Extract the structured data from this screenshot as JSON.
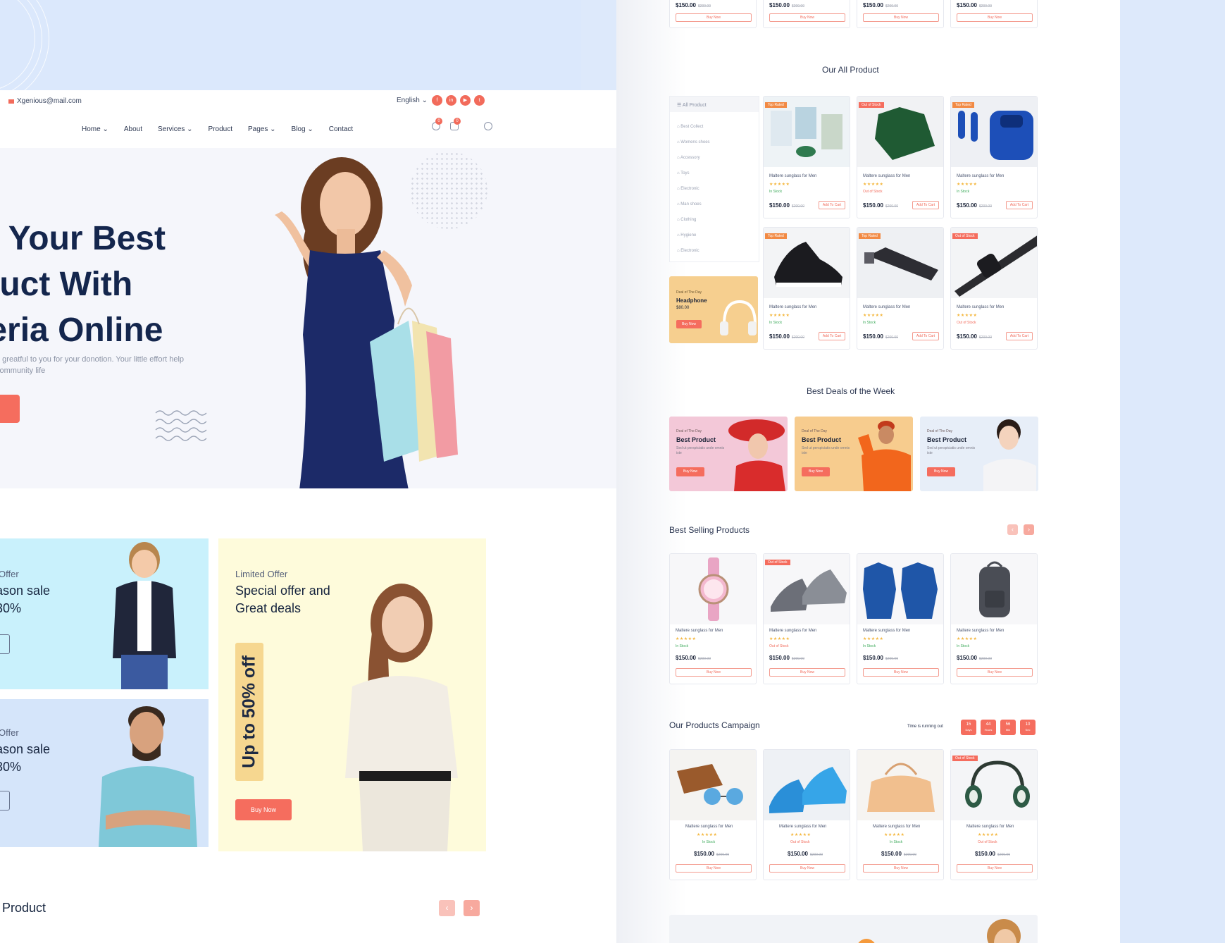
{
  "left": {
    "topbar": {
      "email": "Xgenious@mail.com",
      "language": "English",
      "socials": [
        "f",
        "in",
        "▶",
        "t"
      ]
    },
    "nav": {
      "items": [
        "Home",
        "About",
        "Services",
        "Product",
        "Pages",
        "Blog",
        "Contact"
      ],
      "wishlist_count": "0",
      "cart_count": "0"
    },
    "hero": {
      "title": "d Your Best duct With leria Online",
      "description": "h greatful to you for your donotion. Your little effort help community life"
    },
    "offers": {
      "kid": {
        "small": "Offer",
        "big": "ason sale 30%"
      },
      "man": {
        "small": "Offer",
        "big": "ason sale 30%"
      },
      "lady": {
        "small": "Limited Offer",
        "big": "Special offer and Great deals",
        "badge": "Up to 50% off",
        "button": "Buy Now"
      }
    },
    "popular_title": "ar Product",
    "arrows": {
      "prev": "‹",
      "next": "›"
    }
  },
  "right": {
    "top_cards": [
      {
        "price": "$150.00",
        "old": "$200.00",
        "buy": "Buy Now"
      },
      {
        "price": "$150.00",
        "old": "$200.00",
        "buy": "Buy Now"
      },
      {
        "price": "$150.00",
        "old": "$200.00",
        "buy": "Buy Now"
      },
      {
        "price": "$150.00",
        "old": "$200.00",
        "buy": "Buy Now"
      }
    ],
    "all_product": {
      "title": "Our All Product",
      "menu_head": "All Product",
      "menu": [
        "Best Collect",
        "Womens shoes",
        "Accessory",
        "Toys",
        "Electronic",
        "Man shoes",
        "Clothing",
        "Hygiene",
        "Electronic"
      ],
      "promo": {
        "small": "Deal of The Day",
        "title": "Headphone",
        "price": "$80.00",
        "button": "Buy Now"
      },
      "cards": [
        {
          "tag": "Top Rated",
          "tag_color": "orange",
          "name": "Maltere sunglass for Men",
          "stars": "★★★★★",
          "stock": "In Stock",
          "price": "$150.00",
          "old": "$200.00",
          "buy": "Add To Cart"
        },
        {
          "tag": "Out of Stock",
          "tag_color": "red",
          "name": "Maltere sunglass for Men",
          "stars": "★★★★★",
          "stock": "Out of Stock",
          "price": "$150.00",
          "old": "$200.00",
          "buy": "Add To Cart"
        },
        {
          "tag": "Top Rated",
          "tag_color": "orange",
          "name": "Maltere sunglass for Men",
          "stars": "★★★★★",
          "stock": "In Stock",
          "price": "$150.00",
          "old": "$200.00",
          "buy": "Add To Cart"
        },
        {
          "tag": "Top Rated",
          "tag_color": "orange",
          "name": "Maltere sunglass for Men",
          "stars": "★★★★★",
          "stock": "In Stock",
          "price": "$150.00",
          "old": "$200.00",
          "buy": "Add To Cart"
        },
        {
          "tag": "Top Rated",
          "tag_color": "orange",
          "name": "Maltere sunglass for Men",
          "stars": "★★★★★",
          "stock": "In Stock",
          "price": "$150.00",
          "old": "$200.00",
          "buy": "Add To Cart"
        },
        {
          "tag": "Out of Stock",
          "tag_color": "red",
          "name": "Maltere sunglass for Men",
          "stars": "★★★★★",
          "stock": "Out of Stock",
          "price": "$150.00",
          "old": "$200.00",
          "buy": "Add To Cart"
        }
      ]
    },
    "deals": {
      "title": "Best Deals of the Week",
      "items": [
        {
          "small": "Deal of The Day",
          "title": "Best Product",
          "desc": "Sed ut perspiciatis unde omnis iste",
          "button": "Buy Now",
          "bg": "#f3c8d8"
        },
        {
          "small": "Deal of The Day",
          "title": "Best Product",
          "desc": "Sed ut perspiciatis unde omnis iste",
          "button": "Buy Now",
          "bg": "#f7cc8e"
        },
        {
          "small": "Deal of The Day",
          "title": "Best Product",
          "desc": "Sed ut perspiciatis unde omnis iste",
          "button": "Buy Now",
          "bg": "#e7eef8"
        }
      ]
    },
    "best_selling": {
      "title": "Best Selling Products",
      "cards": [
        {
          "tag": "",
          "name": "Maltere sunglass for Men",
          "stars": "★★★★★",
          "stock": "In Stock",
          "price": "$150.00",
          "old": "$200.00",
          "buy": "Buy Now"
        },
        {
          "tag": "Out of Stock",
          "name": "Maltere sunglass for Men",
          "stars": "★★★★★",
          "stock": "Out of Stock",
          "price": "$150.00",
          "old": "$200.00",
          "buy": "Buy Now"
        },
        {
          "tag": "",
          "name": "Maltere sunglass for Men",
          "stars": "★★★★★",
          "stock": "In Stock",
          "price": "$150.00",
          "old": "$200.00",
          "buy": "Buy Now"
        },
        {
          "tag": "",
          "name": "Maltere sunglass for Men",
          "stars": "★★★★★",
          "stock": "In Stock",
          "price": "$150.00",
          "old": "$200.00",
          "buy": "Buy Now"
        }
      ]
    },
    "campaign": {
      "title": "Our Products Campaign",
      "timer_label": "Time is running out",
      "timer": [
        {
          "value": "15",
          "unit": "Days"
        },
        {
          "value": "44",
          "unit": "Hours"
        },
        {
          "value": "56",
          "unit": "Min"
        },
        {
          "value": "10",
          "unit": "Sec"
        }
      ],
      "cards": [
        {
          "tag": "",
          "name": "Maltere sunglass for Men",
          "stars": "★★★★★",
          "stock": "In Stock",
          "price": "$150.00",
          "old": "$200.00",
          "buy": "Buy Now"
        },
        {
          "tag": "",
          "name": "Maltere sunglass for Men",
          "stars": "★★★★★",
          "stock": "Out of Stock",
          "price": "$150.00",
          "old": "$200.00",
          "buy": "Buy Now"
        },
        {
          "tag": "",
          "name": "Maltere sunglass for Men",
          "stars": "★★★★★",
          "stock": "In Stock",
          "price": "$150.00",
          "old": "$200.00",
          "buy": "Buy Now"
        },
        {
          "tag": "Out of Stock",
          "name": "Maltere sunglass for Men",
          "stars": "★★★★★",
          "stock": "Out of Stock",
          "price": "$150.00",
          "old": "$200.00",
          "buy": "Buy Now"
        }
      ]
    }
  },
  "colors": {
    "accent": "#f56d5e",
    "navy": "#14264d",
    "background": "#dde9fb"
  }
}
